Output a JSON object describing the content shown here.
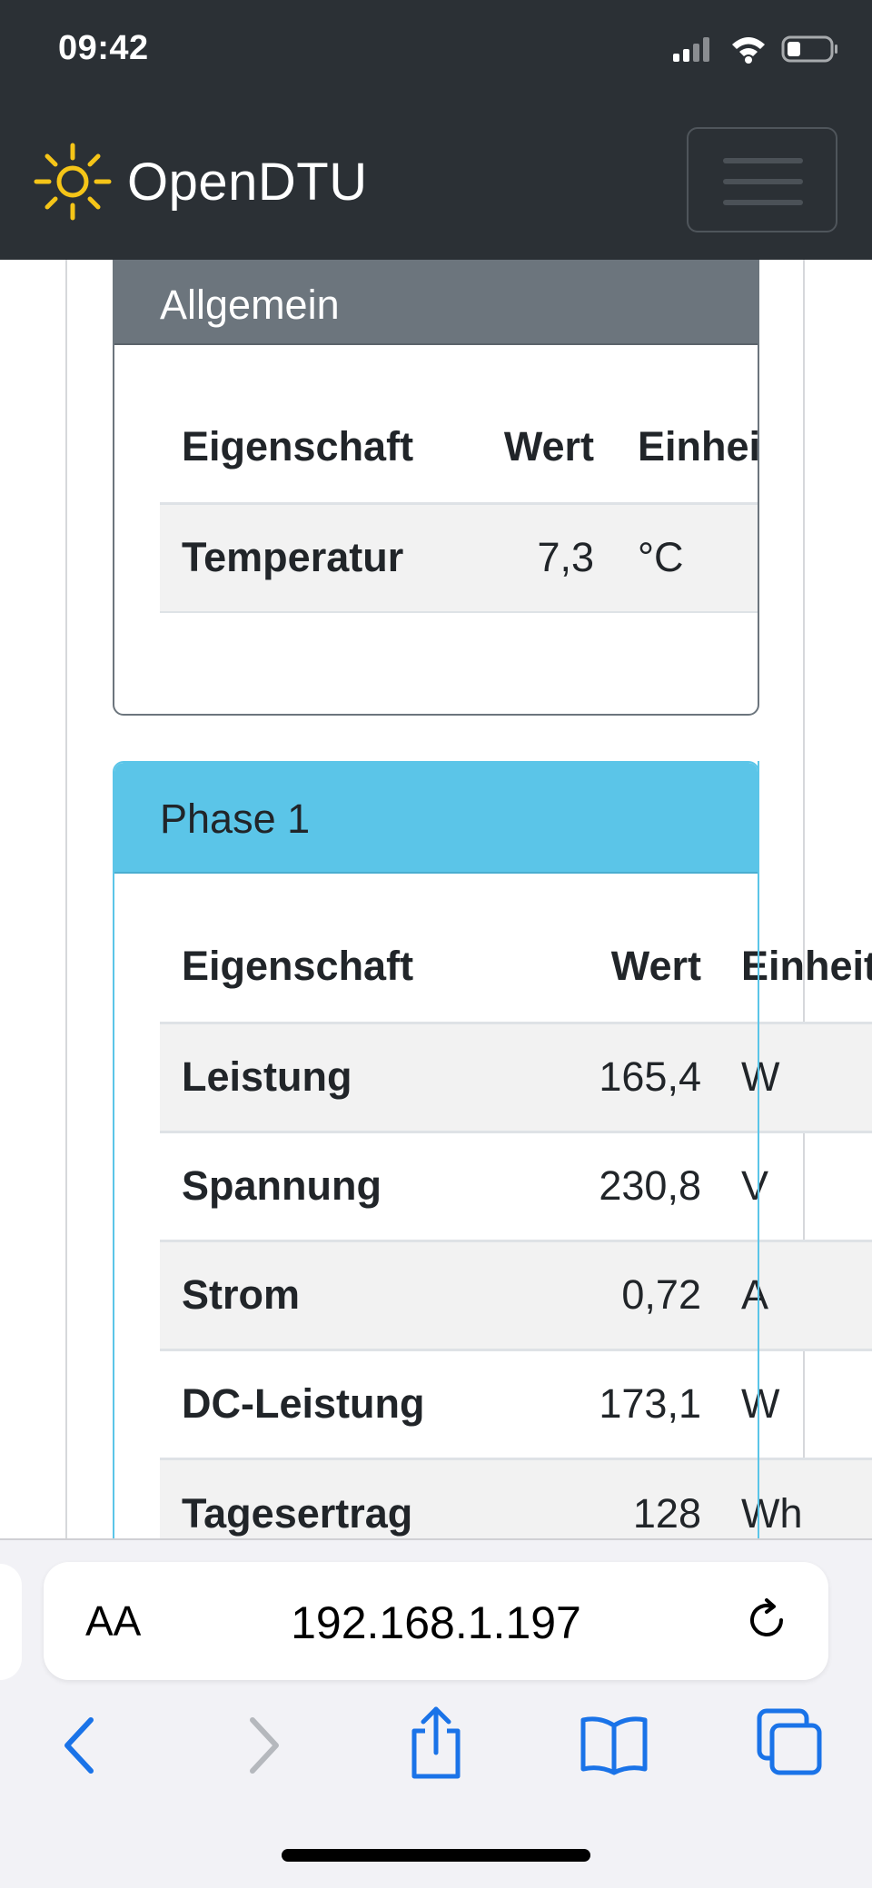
{
  "status_bar": {
    "time": "09:42"
  },
  "navbar": {
    "brand": "OpenDTU"
  },
  "allgemein": {
    "title": "Allgemein",
    "headers": [
      "Eigenschaft",
      "Wert",
      "Einheit"
    ],
    "rows": [
      {
        "property": "Temperatur",
        "value": "7,3",
        "unit": "°C"
      }
    ]
  },
  "phase1": {
    "title": "Phase 1",
    "headers": [
      "Eigenschaft",
      "Wert",
      "Einheit"
    ],
    "rows": [
      {
        "property": "Leistung",
        "value": "165,4",
        "unit": "W"
      },
      {
        "property": "Spannung",
        "value": "230,8",
        "unit": "V"
      },
      {
        "property": "Strom",
        "value": "0,72",
        "unit": "A"
      },
      {
        "property": "DC-Leistung",
        "value": "173,1",
        "unit": "W"
      },
      {
        "property": "Tagesertrag",
        "value": "128",
        "unit": "Wh"
      }
    ]
  },
  "browser": {
    "text_size_label": "AA",
    "url": "192.168.1.197"
  },
  "colors": {
    "navbar": "#2b3035",
    "secondary": "#6c757d",
    "info": "#5bc5e8",
    "brand_sun": "#f5c518",
    "ios_blue": "#1a73e8"
  },
  "icons": {
    "brand": "sun-icon",
    "status": [
      "signal-icon",
      "wifi-icon",
      "battery-icon"
    ],
    "toolbar": [
      "back-icon",
      "forward-icon",
      "share-icon",
      "bookmarks-icon",
      "tabs-icon"
    ]
  }
}
